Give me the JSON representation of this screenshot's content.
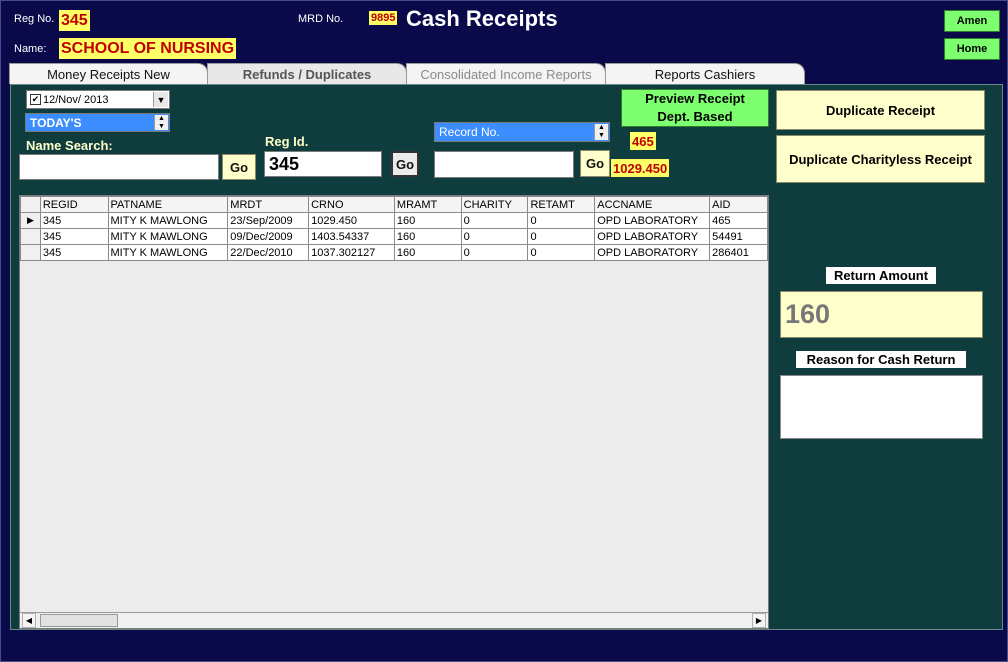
{
  "header": {
    "reg_no_label": "Reg No.",
    "reg_no_value": "345",
    "mrd_no_label": "MRD No.",
    "mrd_no_value": "9895",
    "title": "Cash Receipts",
    "name_label": "Name:",
    "name_value": "SCHOOL OF NURSING",
    "amen_button": "Amen",
    "home_button": "Home"
  },
  "tabs": [
    {
      "label": "Money Receipts New",
      "state": "normal"
    },
    {
      "label": "Refunds / Duplicates",
      "state": "active"
    },
    {
      "label": "Consolidated Income Reports",
      "state": "disabled"
    },
    {
      "label": "Reports Cashiers",
      "state": "normal"
    }
  ],
  "filters": {
    "date_checkbox_checked": true,
    "date_value": "12/Nov/ 2013",
    "period_value": "TODAY'S",
    "name_search_label": "Name Search:",
    "name_search_value": "",
    "go_label": "Go",
    "reg_id_label": "Reg Id.",
    "reg_id_value": "345",
    "record_no_value": "Record No.",
    "record_search_value": "",
    "record_value_1": "465",
    "record_value_2": "1029.450"
  },
  "actions": {
    "preview_line1": "Preview Receipt",
    "preview_line2": "Dept. Based",
    "duplicate_receipt": "Duplicate Receipt",
    "duplicate_charityless": "Duplicate Charityless Receipt"
  },
  "grid": {
    "columns": [
      "REGID",
      "PATNAME",
      "MRDT",
      "CRNO",
      "MRAMT",
      "CHARITY",
      "RETAMT",
      "ACCNAME",
      "AID"
    ],
    "rows": [
      [
        "345",
        "MITY K MAWLONG",
        "23/Sep/2009",
        "1029.450",
        "160",
        "0",
        "0",
        "OPD LABORATORY",
        "465"
      ],
      [
        "345",
        "MITY K MAWLONG",
        "09/Dec/2009",
        "1403.54337",
        "160",
        "0",
        "0",
        "OPD LABORATORY",
        "54491"
      ],
      [
        "345",
        "MITY K MAWLONG",
        "22/Dec/2010",
        "1037.302127",
        "160",
        "0",
        "0",
        "OPD LABORATORY",
        "286401"
      ]
    ],
    "selected_row": 0
  },
  "return": {
    "amount_label": "Return Amount",
    "amount_value": "160",
    "reason_label": "Reason for Cash Return",
    "reason_value": ""
  },
  "icons": {
    "dropdown": "chevron-down-icon",
    "spinner": "spin-arrows-icon",
    "row_pointer": "triangle-right-icon"
  },
  "colors": {
    "background": "#0a0a4a",
    "panel": "#0f3d3d",
    "highlight_yellow": "#ffff66",
    "value_red": "#c00000",
    "button_green": "#7dff6f",
    "button_cream": "#ffffcc",
    "combo_blue": "#3c8dff"
  }
}
